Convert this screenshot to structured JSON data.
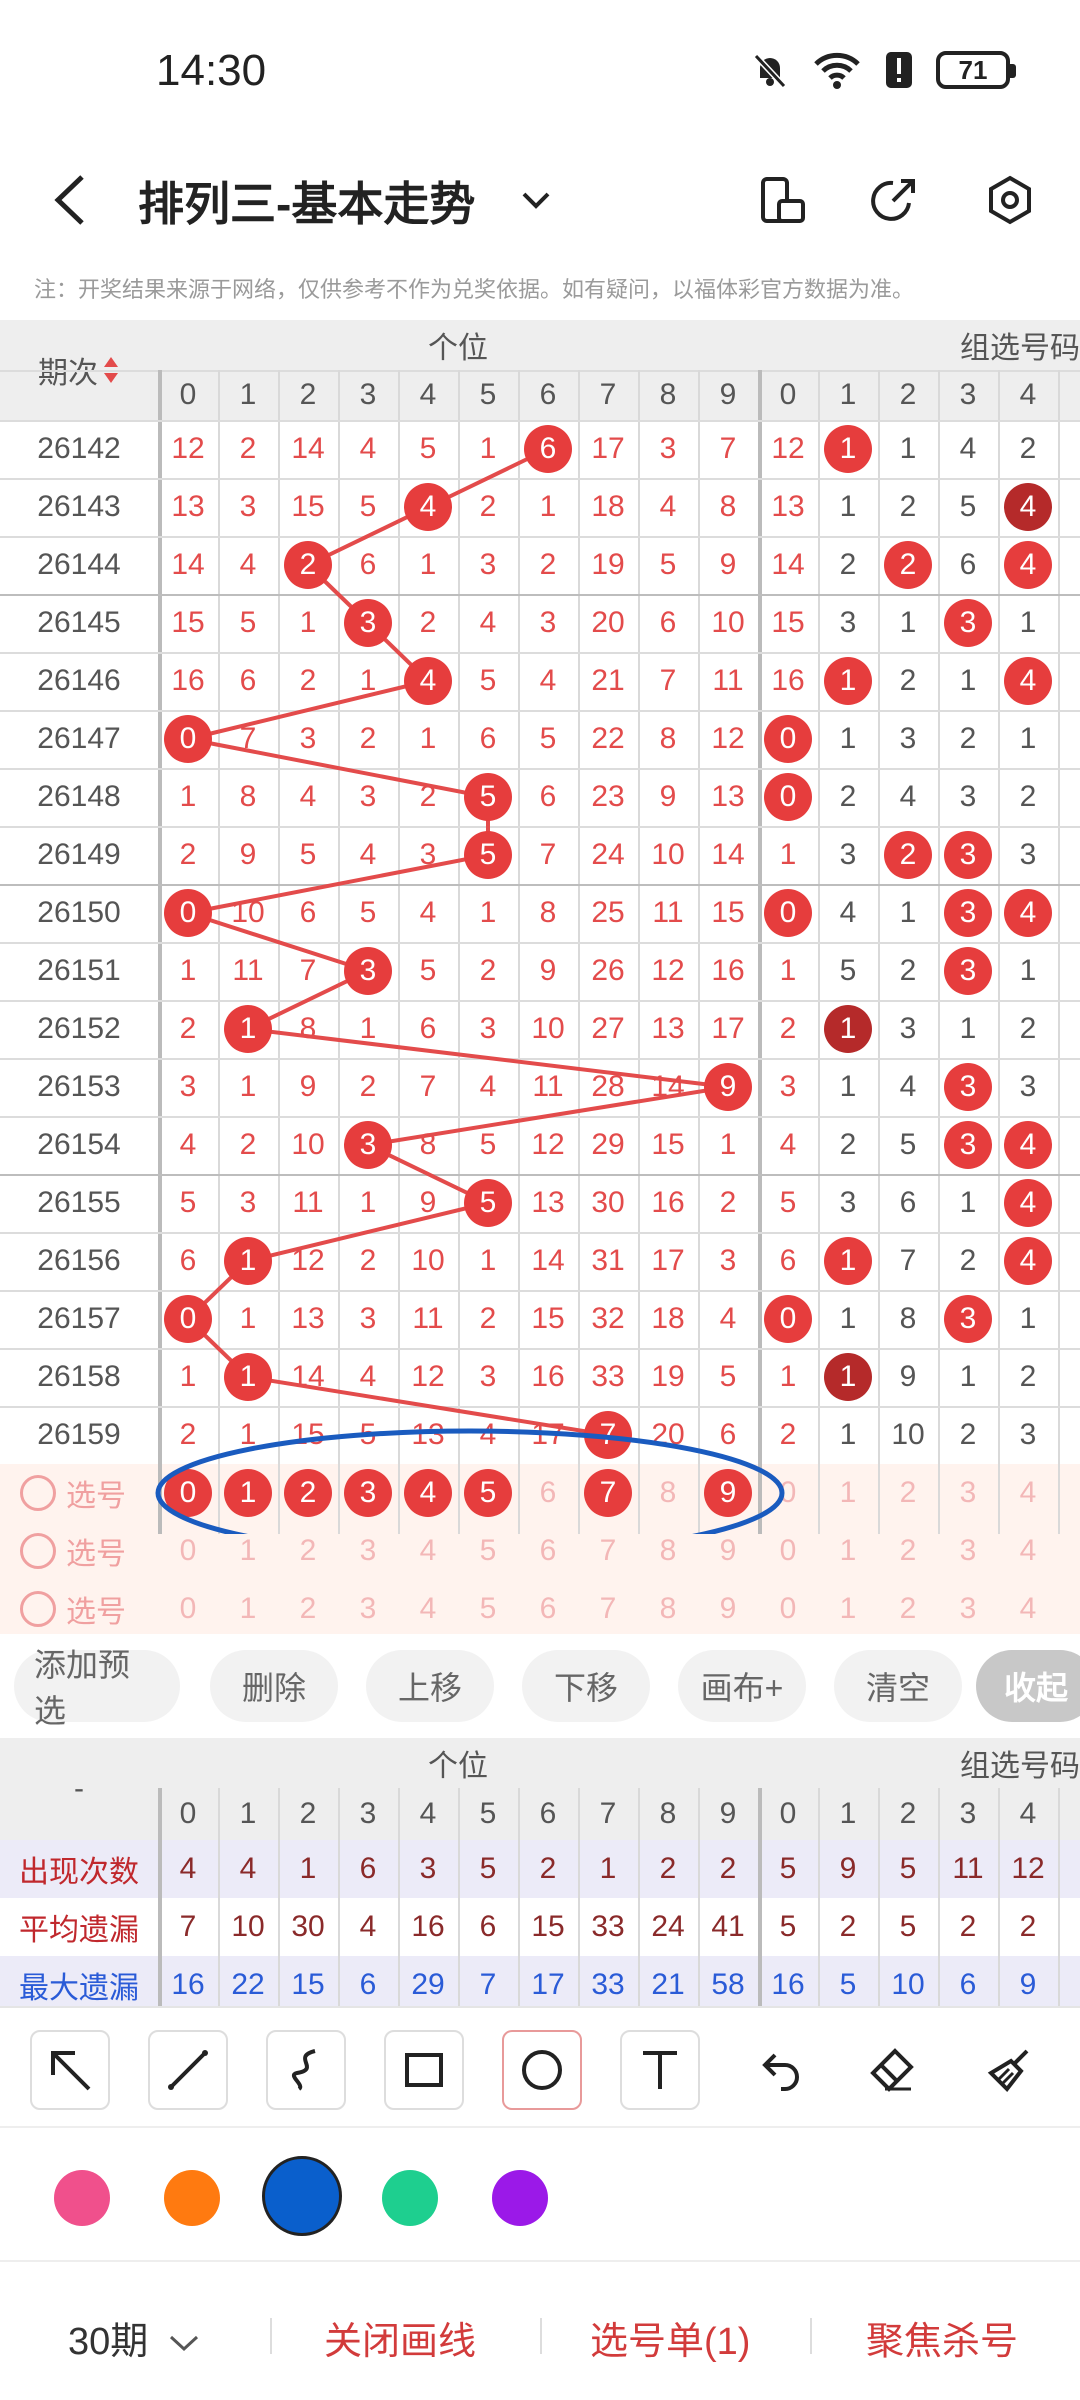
{
  "status": {
    "time": "14:30",
    "battery": "71"
  },
  "header": {
    "title": "排列三-基本走势"
  },
  "note": "注：开奖结果来源于网络，仅供参考不作为兑奖依据。如有疑问，以福体彩官方数据为准。",
  "table": {
    "period_header": "期次",
    "group1_title": "个位",
    "group2_title": "组选号码",
    "digits": [
      "0",
      "1",
      "2",
      "3",
      "4",
      "5",
      "6",
      "7",
      "8",
      "9"
    ],
    "group2_digits": [
      "0",
      "1",
      "2",
      "3",
      "4"
    ],
    "rows": [
      {
        "period": "26142",
        "vals": [
          "12",
          "2",
          "14",
          "4",
          "5",
          "1",
          "6",
          "17",
          "3",
          "7"
        ],
        "g2": [
          "12",
          "1",
          "1",
          "4",
          "2"
        ]
      },
      {
        "period": "26143",
        "vals": [
          "13",
          "3",
          "15",
          "5",
          "4",
          "2",
          "1",
          "18",
          "4",
          "8"
        ],
        "g2": [
          "13",
          "1",
          "2",
          "5",
          "4"
        ]
      },
      {
        "period": "26144",
        "vals": [
          "14",
          "4",
          "2",
          "6",
          "1",
          "3",
          "2",
          "19",
          "5",
          "9"
        ],
        "g2": [
          "14",
          "2",
          "2",
          "6",
          "4"
        ]
      },
      {
        "period": "26145",
        "vals": [
          "15",
          "5",
          "1",
          "3",
          "2",
          "4",
          "3",
          "20",
          "6",
          "10"
        ],
        "g2": [
          "15",
          "3",
          "1",
          "3",
          "1"
        ]
      },
      {
        "period": "26146",
        "vals": [
          "16",
          "6",
          "2",
          "1",
          "4",
          "5",
          "4",
          "21",
          "7",
          "11"
        ],
        "g2": [
          "16",
          "1",
          "2",
          "1",
          "4"
        ]
      },
      {
        "period": "26147",
        "vals": [
          "0",
          "7",
          "3",
          "2",
          "1",
          "6",
          "5",
          "22",
          "8",
          "12"
        ],
        "g2": [
          "0",
          "1",
          "3",
          "2",
          "1"
        ]
      },
      {
        "period": "26148",
        "vals": [
          "1",
          "8",
          "4",
          "3",
          "2",
          "5",
          "6",
          "23",
          "9",
          "13"
        ],
        "g2": [
          "0",
          "2",
          "4",
          "3",
          "2"
        ]
      },
      {
        "period": "26149",
        "vals": [
          "2",
          "9",
          "5",
          "4",
          "3",
          "5",
          "7",
          "24",
          "10",
          "14"
        ],
        "g2": [
          "1",
          "3",
          "2",
          "3",
          "3"
        ]
      },
      {
        "period": "26150",
        "vals": [
          "0",
          "10",
          "6",
          "5",
          "4",
          "1",
          "8",
          "25",
          "11",
          "15"
        ],
        "g2": [
          "0",
          "4",
          "1",
          "3",
          "4"
        ]
      },
      {
        "period": "26151",
        "vals": [
          "1",
          "11",
          "7",
          "3",
          "5",
          "2",
          "9",
          "26",
          "12",
          "16"
        ],
        "g2": [
          "1",
          "5",
          "2",
          "3",
          "1"
        ]
      },
      {
        "period": "26152",
        "vals": [
          "2",
          "1",
          "8",
          "1",
          "6",
          "3",
          "10",
          "27",
          "13",
          "17"
        ],
        "g2": [
          "2",
          "1",
          "3",
          "1",
          "2"
        ]
      },
      {
        "period": "26153",
        "vals": [
          "3",
          "1",
          "9",
          "2",
          "7",
          "4",
          "11",
          "28",
          "14",
          "9"
        ],
        "g2": [
          "3",
          "1",
          "4",
          "3",
          "3"
        ]
      },
      {
        "period": "26154",
        "vals": [
          "4",
          "2",
          "10",
          "3",
          "8",
          "5",
          "12",
          "29",
          "15",
          "1"
        ],
        "g2": [
          "4",
          "2",
          "5",
          "3",
          "4"
        ]
      },
      {
        "period": "26155",
        "vals": [
          "5",
          "3",
          "11",
          "1",
          "9",
          "5",
          "13",
          "30",
          "16",
          "2"
        ],
        "g2": [
          "5",
          "3",
          "6",
          "1",
          "4"
        ]
      },
      {
        "period": "26156",
        "vals": [
          "6",
          "1",
          "12",
          "2",
          "10",
          "1",
          "14",
          "31",
          "17",
          "3"
        ],
        "g2": [
          "6",
          "1",
          "7",
          "2",
          "4"
        ]
      },
      {
        "period": "26157",
        "vals": [
          "0",
          "1",
          "13",
          "3",
          "11",
          "2",
          "15",
          "32",
          "18",
          "4"
        ],
        "g2": [
          "0",
          "1",
          "8",
          "3",
          "1"
        ]
      },
      {
        "period": "26158",
        "vals": [
          "1",
          "1",
          "14",
          "4",
          "12",
          "3",
          "16",
          "33",
          "19",
          "5"
        ],
        "g2": [
          "1",
          "1",
          "9",
          "1",
          "2"
        ]
      },
      {
        "period": "26159",
        "vals": [
          "2",
          "1",
          "15",
          "5",
          "13",
          "4",
          "17",
          "7",
          "20",
          "6"
        ],
        "g2": [
          "2",
          "1",
          "10",
          "2",
          "3"
        ]
      }
    ],
    "select_label": "选号",
    "selected_row": [
      "0",
      "1",
      "2",
      "3",
      "4",
      "5",
      "6",
      "7",
      "8",
      "9"
    ],
    "selected_flags": [
      true,
      true,
      true,
      true,
      true,
      true,
      false,
      true,
      false,
      true
    ]
  },
  "actions": {
    "add": "添加预选",
    "delete": "删除",
    "up": "上移",
    "down": "下移",
    "canvas": "画布+",
    "clear": "清空",
    "collapse": "收起"
  },
  "stats": {
    "dash": "-",
    "group1_title": "个位",
    "group2_title": "组选号码",
    "appear_label": "出现次数",
    "avg_label": "平均遗漏",
    "max_label": "最大遗漏",
    "appear": [
      "4",
      "4",
      "1",
      "6",
      "3",
      "5",
      "2",
      "1",
      "2",
      "2"
    ],
    "appear_g2": [
      "5",
      "9",
      "5",
      "11",
      "12"
    ],
    "avg": [
      "7",
      "10",
      "30",
      "4",
      "16",
      "6",
      "15",
      "33",
      "24",
      "41"
    ],
    "avg_g2": [
      "5",
      "2",
      "5",
      "2",
      "2"
    ],
    "max": [
      "16",
      "22",
      "15",
      "6",
      "29",
      "7",
      "17",
      "33",
      "21",
      "58"
    ],
    "max_g2": [
      "16",
      "5",
      "10",
      "6",
      "9"
    ]
  },
  "colors": [
    "#f0508c",
    "#ff7a10",
    "#0a5fcc",
    "#1ecf8f",
    "#9b19e8"
  ],
  "bottom": {
    "periods": "30期",
    "close_lines": "关闭画线",
    "ticket": "选号单(1)",
    "focus": "聚焦杀号"
  }
}
